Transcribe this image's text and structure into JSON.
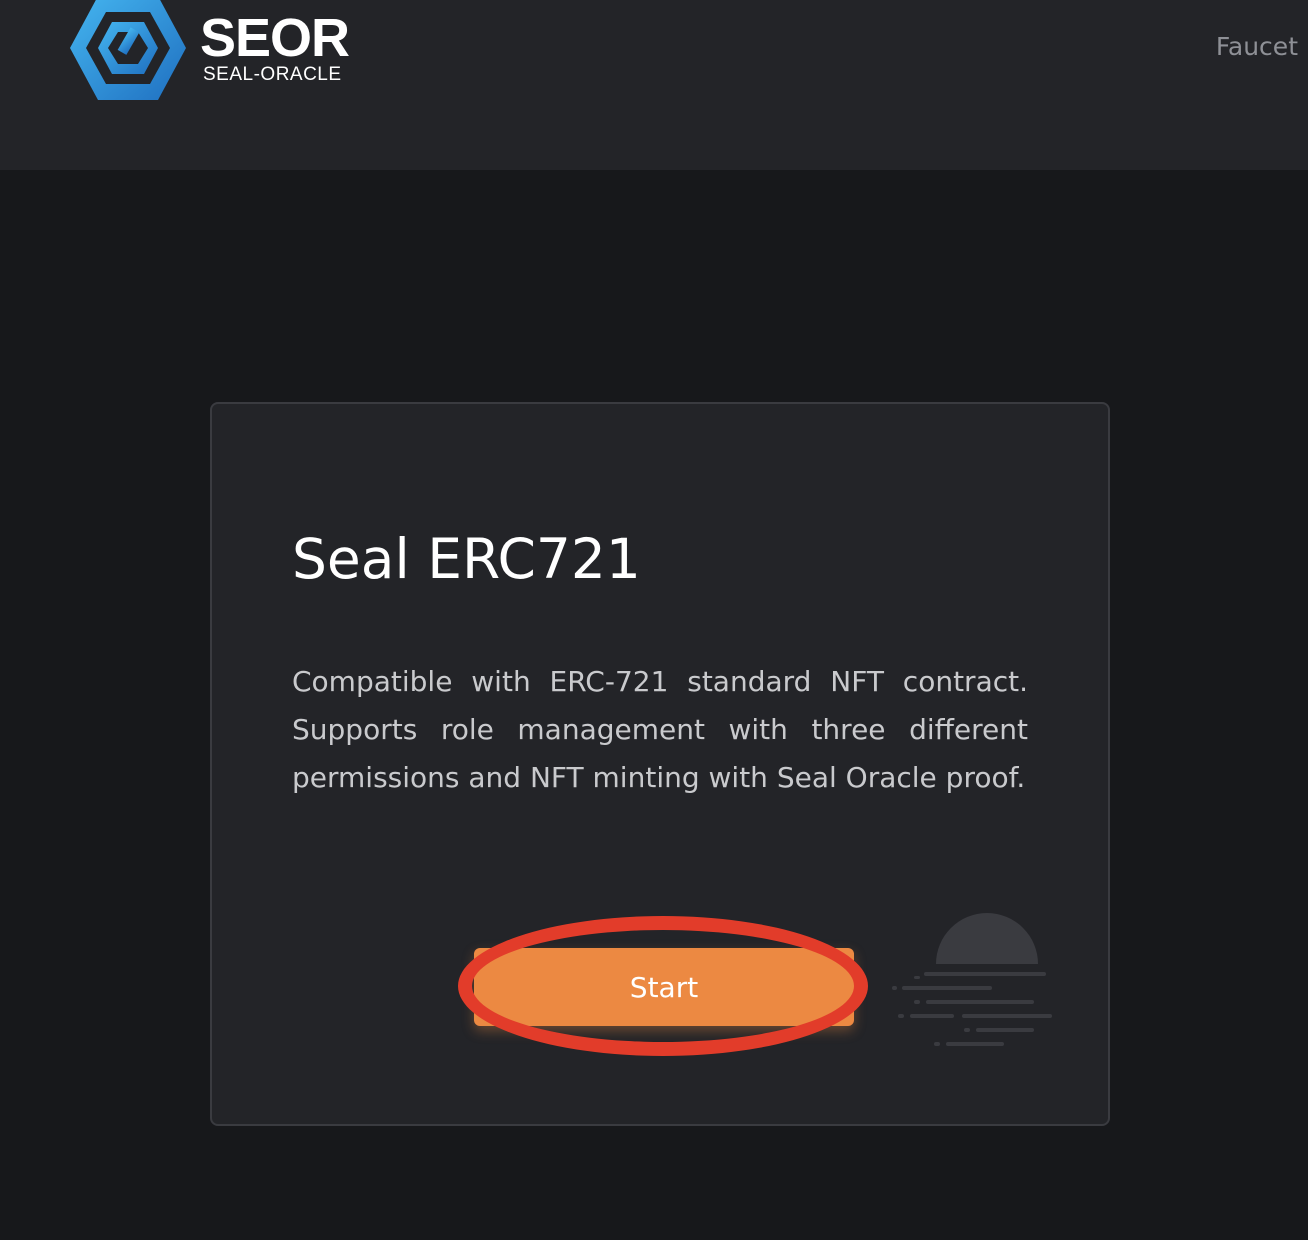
{
  "header": {
    "brand_name": "SEOR",
    "brand_subtitle": "SEAL-ORACLE",
    "logo_icon": "hexagon-logo-icon",
    "nav_link": "Faucet"
  },
  "card": {
    "title": "Seal ERC721",
    "description": "Compatible with ERC-721 standard NFT contract. Supports role management with three different permissions and NFT minting with Seal Oracle proof.",
    "start_label": "Start",
    "illustration_icon": "sunset-lines-icon"
  },
  "colors": {
    "page_bg": "#17181b",
    "header_bg": "#232428",
    "card_bg": "#232428",
    "accent": "#ec8942",
    "highlight": "#e23c2a",
    "logo_blue": "#2f8fd8"
  }
}
